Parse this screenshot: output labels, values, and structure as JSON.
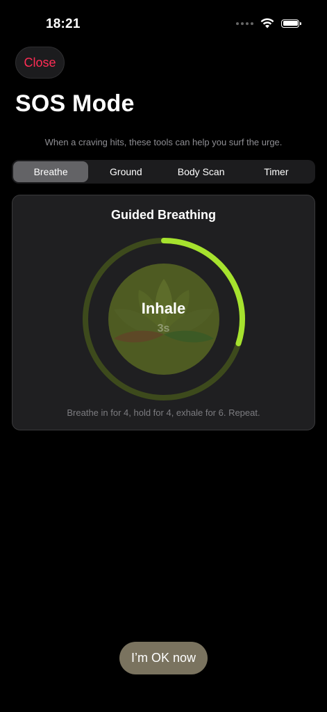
{
  "status_bar": {
    "time": "18:21",
    "icons": [
      "signal-dots-icon",
      "wifi-icon",
      "battery-icon"
    ]
  },
  "header": {
    "close_label": "Close",
    "title": "SOS Mode",
    "subtitle": "When a craving hits, these tools can help you surf the urge."
  },
  "tabs": [
    {
      "label": "Breathe",
      "active": true
    },
    {
      "label": "Ground",
      "active": false
    },
    {
      "label": "Body Scan",
      "active": false
    },
    {
      "label": "Timer",
      "active": false
    }
  ],
  "breathing": {
    "title": "Guided Breathing",
    "phase": "Inhale",
    "count": "3s",
    "progress": 0.3,
    "instruction": "Breathe in for 4, hold for 4, exhale for 6. Repeat."
  },
  "footer": {
    "ok_label": "I’m OK now"
  },
  "colors": {
    "accent_close": "#ff2d55",
    "progress_ring": "#a6e22e",
    "ring_track": "#3d4a1c",
    "inner_circle": "#4e5b22",
    "ok_button": "#7a735f"
  }
}
